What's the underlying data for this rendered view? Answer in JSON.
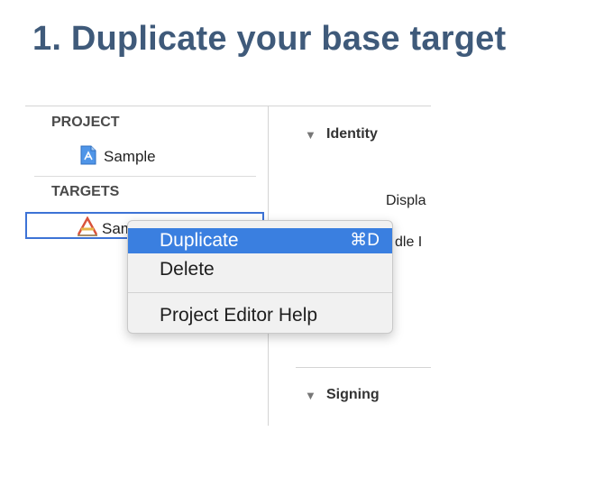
{
  "headline": "1. Duplicate your base target",
  "sidebar": {
    "project_header": "PROJECT",
    "project_item": "Sample",
    "targets_header": "TARGETS",
    "target_item": "Sam"
  },
  "editor": {
    "identity_section": "Identity",
    "display_label": "Displa",
    "bundle_label": "dle I",
    "signing_section": "Signing"
  },
  "context_menu": {
    "duplicate_label": "Duplicate",
    "duplicate_shortcut": "⌘D",
    "delete_label": "Delete",
    "help_label": "Project Editor Help"
  },
  "colors": {
    "headline": "#3f5a7a",
    "selection": "#3a7fe0",
    "target_border": "#3d73d6"
  }
}
